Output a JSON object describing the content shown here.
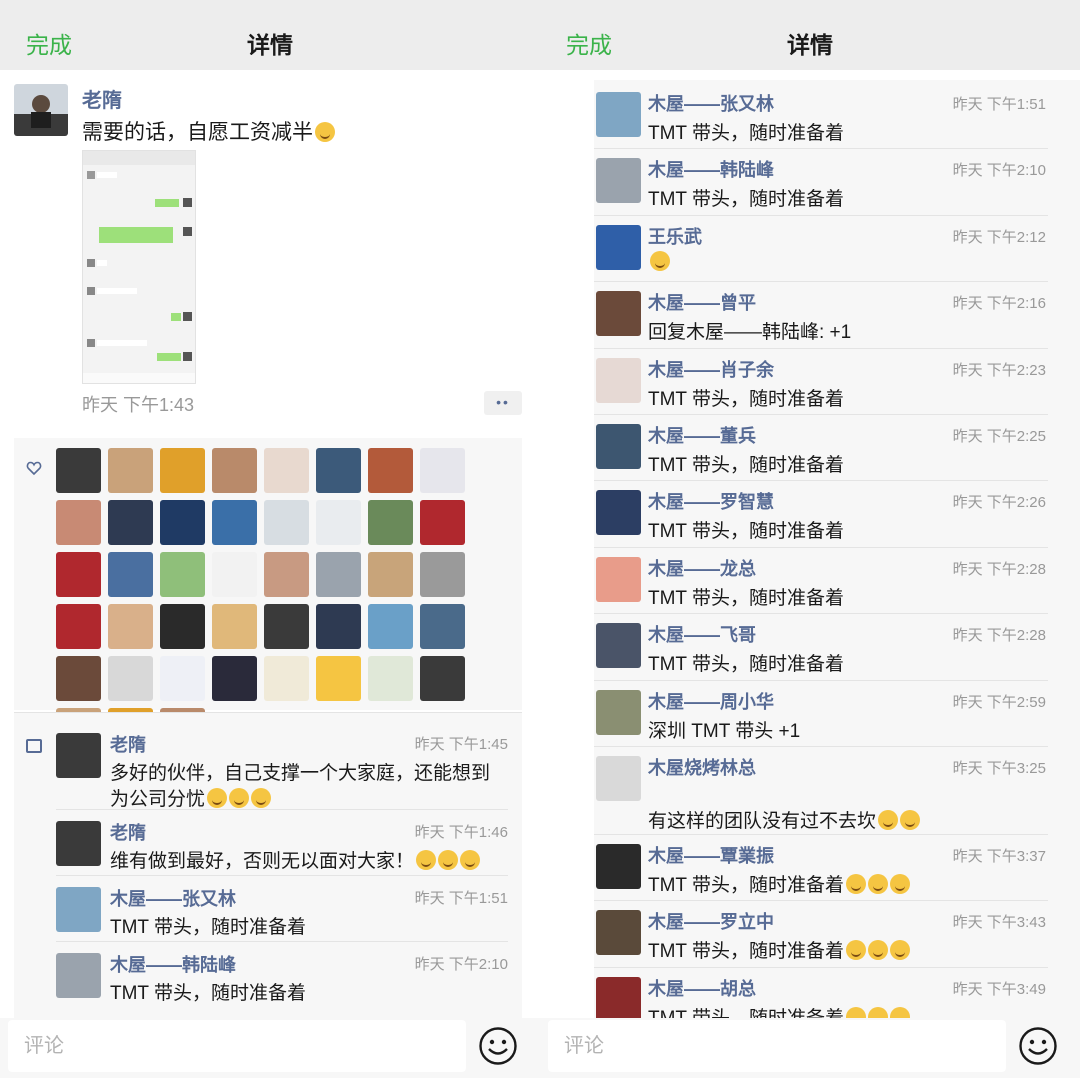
{
  "left": {
    "topbar": {
      "done_label": "完成",
      "title": "详情"
    },
    "post": {
      "author": "老隋",
      "text": "需要的话，自愿工资减半",
      "time": "昨天 下午1:43",
      "more_label": "••"
    },
    "likes_count_shown": 43,
    "comments": [
      {
        "name": "老隋",
        "time": "昨天 下午1:45",
        "text": "多好的伙伴，自己支撑一个大家庭，还能想到为公司分忧",
        "emoji_count": 3,
        "avatar_color": "#3a3a3a"
      },
      {
        "name": "老隋",
        "time": "昨天 下午1:46",
        "text": "维有做到最好，否则无以面对大家！",
        "emoji_count": 3,
        "avatar_color": "#3a3a3a"
      },
      {
        "name": "木屋——张又林",
        "time": "昨天 下午1:51",
        "text": "TMT 带头，随时准备着",
        "emoji_count": 0,
        "avatar_color": "#7fa6c4"
      },
      {
        "name": "木屋——韩陆峰",
        "time": "昨天 下午2:10",
        "text": "TMT 带头，随时准备着",
        "emoji_count": 0,
        "avatar_color": "#9aa3ad"
      }
    ],
    "input": {
      "placeholder": "评论"
    }
  },
  "right": {
    "topbar": {
      "done_label": "完成",
      "title": "详情"
    },
    "comments": [
      {
        "name": "木屋——张又林",
        "time": "昨天 下午1:51",
        "text": "TMT 带头，随时准备着",
        "emoji_count": 0,
        "avatar_color": "#7fa6c4"
      },
      {
        "name": "木屋——韩陆峰",
        "time": "昨天 下午2:10",
        "text": "TMT 带头，随时准备着",
        "emoji_count": 0,
        "avatar_color": "#9aa3ad"
      },
      {
        "name": "王乐武",
        "time": "昨天 下午2:12",
        "text": "",
        "emoji_count": 1,
        "avatar_color": "#2f5fa8"
      },
      {
        "name": "木屋——曾平",
        "time": "昨天 下午2:16",
        "text": "回复木屋——韩陆峰: +1",
        "emoji_count": 0,
        "avatar_color": "#6b4a3a"
      },
      {
        "name": "木屋——肖子余",
        "time": "昨天 下午2:23",
        "text": "TMT 带头，随时准备着",
        "emoji_count": 0,
        "avatar_color": "#e6d9d4"
      },
      {
        "name": "木屋——董兵",
        "time": "昨天 下午2:25",
        "text": "TMT 带头，随时准备着",
        "emoji_count": 0,
        "avatar_color": "#3d5670"
      },
      {
        "name": "木屋——罗智慧",
        "time": "昨天 下午2:26",
        "text": "TMT 带头，随时准备着",
        "emoji_count": 0,
        "avatar_color": "#2c3e63"
      },
      {
        "name": "木屋——龙总",
        "time": "昨天 下午2:28",
        "text": "TMT 带头，随时准备着",
        "emoji_count": 0,
        "avatar_color": "#e89c8a"
      },
      {
        "name": "木屋——飞哥",
        "time": "昨天 下午2:28",
        "text": "TMT 带头，随时准备着",
        "emoji_count": 0,
        "avatar_color": "#4a5468"
      },
      {
        "name": "木屋——周小华",
        "time": "昨天 下午2:59",
        "text": "深圳 TMT 带头 +1",
        "emoji_count": 0,
        "avatar_color": "#8a8f72"
      },
      {
        "name": "木屋烧烤林总",
        "time": "昨天 下午3:25",
        "text": "有这样的团队没有过不去坎",
        "emoji_count": 2,
        "avatar_color": "#d9d9d9",
        "tall": true
      },
      {
        "name": "木屋——覃業振",
        "time": "昨天 下午3:37",
        "text": "TMT 带头，随时准备着",
        "emoji_count": 3,
        "avatar_color": "#2a2a2a"
      },
      {
        "name": "木屋——罗立中",
        "time": "昨天 下午3:43",
        "text": "TMT 带头，随时准备着",
        "emoji_count": 3,
        "avatar_color": "#5a4a3a"
      },
      {
        "name": "木屋——胡总",
        "time": "昨天 下午3:49",
        "text": "TMT 带头，随时准备着",
        "emoji_count": 3,
        "avatar_color": "#8a2a2a"
      }
    ],
    "input": {
      "placeholder": "评论"
    }
  },
  "colors": {
    "accent_green": "#3bb34a",
    "link_blue": "#576b95",
    "meta_gray": "#999999",
    "bar_bg": "#ededed",
    "panel_bg": "#f7f7f7"
  },
  "icons": {
    "heart": "heart-icon",
    "comment": "comment-icon",
    "emoji": "emoji-face-icon"
  }
}
